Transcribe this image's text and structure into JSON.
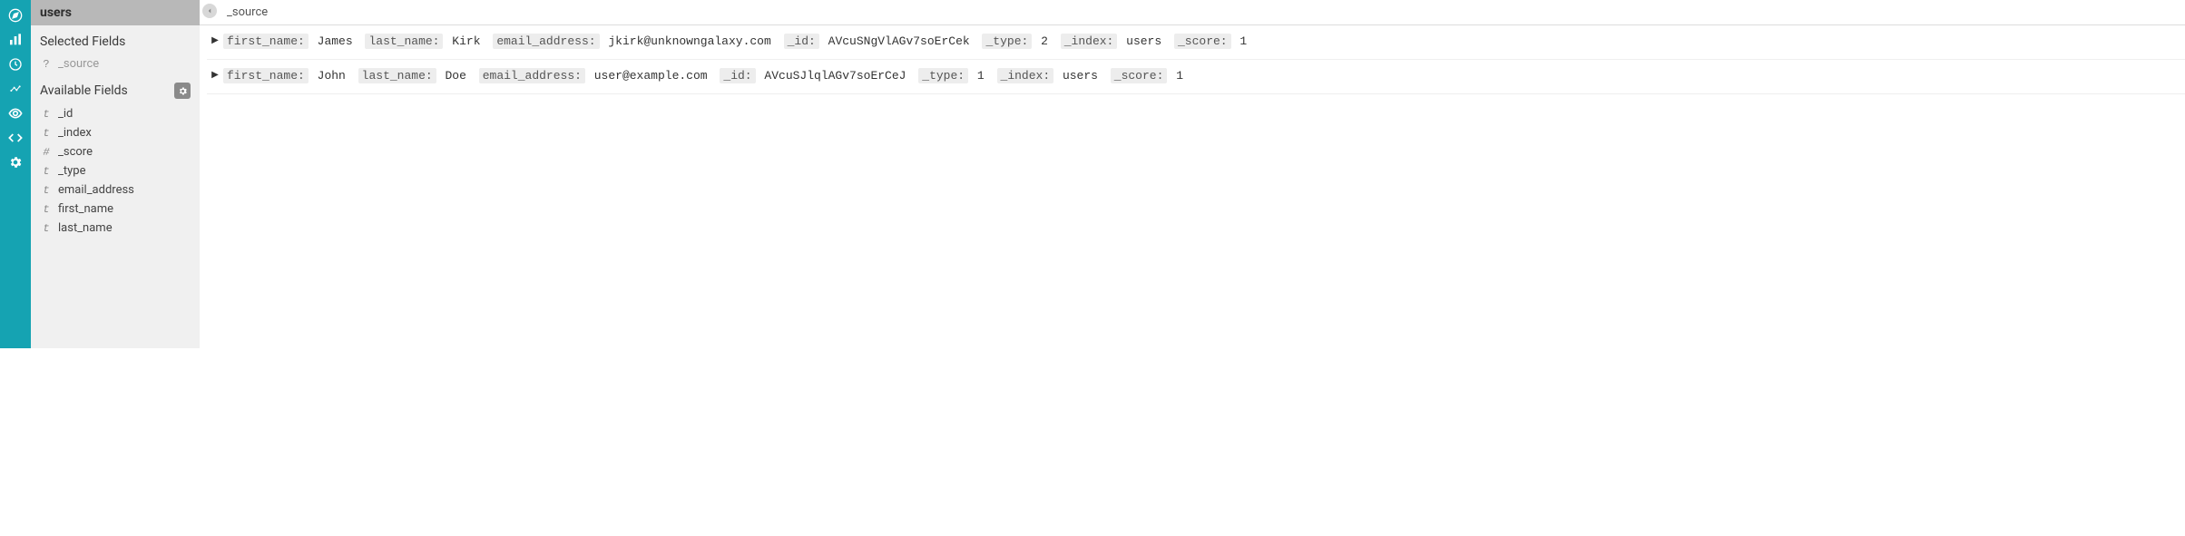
{
  "indexPattern": "users",
  "sidebar": {
    "selectedTitle": "Selected Fields",
    "availableTitle": "Available Fields",
    "selected": [
      {
        "type": "?",
        "name": "_source"
      }
    ],
    "available": [
      {
        "type": "t",
        "name": "_id"
      },
      {
        "type": "t",
        "name": "_index"
      },
      {
        "type": "#",
        "name": "_score"
      },
      {
        "type": "t",
        "name": "_type"
      },
      {
        "type": "t",
        "name": "email_address"
      },
      {
        "type": "t",
        "name": "first_name"
      },
      {
        "type": "t",
        "name": "last_name"
      }
    ]
  },
  "columnHeader": "_source",
  "docs": [
    {
      "fields": [
        {
          "k": "first_name:",
          "v": "James"
        },
        {
          "k": "last_name:",
          "v": "Kirk"
        },
        {
          "k": "email_address:",
          "v": "jkirk@unknowngalaxy.com"
        },
        {
          "k": "_id:",
          "v": "AVcuSNgVlAGv7soErCek"
        },
        {
          "k": "_type:",
          "v": "2"
        },
        {
          "k": "_index:",
          "v": "users"
        },
        {
          "k": "_score:",
          "v": "1"
        }
      ]
    },
    {
      "fields": [
        {
          "k": "first_name:",
          "v": "John"
        },
        {
          "k": "last_name:",
          "v": "Doe"
        },
        {
          "k": "email_address:",
          "v": "user@example.com"
        },
        {
          "k": "_id:",
          "v": "AVcuSJlqlAGv7soErCeJ"
        },
        {
          "k": "_type:",
          "v": "1"
        },
        {
          "k": "_index:",
          "v": "users"
        },
        {
          "k": "_score:",
          "v": "1"
        }
      ]
    }
  ]
}
